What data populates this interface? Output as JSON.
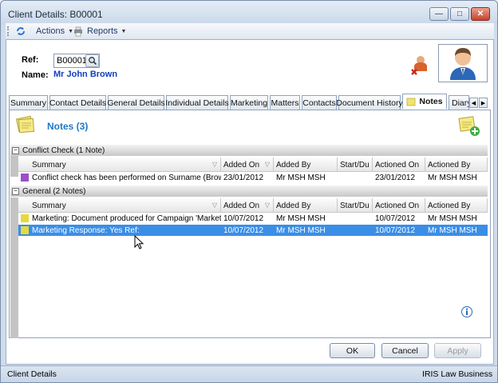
{
  "window": {
    "title": "Client Details: B00001"
  },
  "toolbar": {
    "actions_label": "Actions",
    "reports_label": "Reports"
  },
  "client": {
    "ref_label": "Ref:",
    "ref_value": "B00001",
    "name_label": "Name:",
    "name_value": "Mr John Brown"
  },
  "tabs": [
    {
      "label": "Summary"
    },
    {
      "label": "Contact Details"
    },
    {
      "label": "General Details"
    },
    {
      "label": "Individual Details"
    },
    {
      "label": "Marketing"
    },
    {
      "label": "Matters"
    },
    {
      "label": "Contacts"
    },
    {
      "label": "Document History"
    },
    {
      "label": "Notes",
      "active": true
    },
    {
      "label": "Diary"
    }
  ],
  "notes": {
    "title": "Notes (3)",
    "columns": [
      "Summary",
      "Added On",
      "Added By",
      "Start/Du",
      "Actioned On",
      "Actioned By"
    ],
    "groups": [
      {
        "label": "Conflict Check (1 Note)",
        "rows": [
          {
            "summary": "Conflict check has been performed on Surname (Brow...",
            "added_on": "23/01/2012",
            "added_by": "Mr MSH MSH",
            "start_due": "",
            "actioned_on": "23/01/2012",
            "actioned_by": "Mr MSH MSH",
            "color": "#9b4fc8",
            "selected": false
          }
        ]
      },
      {
        "label": "General (2 Notes)",
        "rows": [
          {
            "summary": "Marketing: Document produced for Campaign 'Marketi...",
            "added_on": "10/07/2012",
            "added_by": "Mr MSH MSH",
            "start_due": "",
            "actioned_on": "10/07/2012",
            "actioned_by": "Mr MSH MSH",
            "color": "#e6d93a",
            "selected": false
          },
          {
            "summary": "Marketing Response: Yes Ref:",
            "added_on": "10/07/2012",
            "added_by": "Mr MSH MSH",
            "start_due": "",
            "actioned_on": "10/07/2012",
            "actioned_by": "Mr MSH MSH",
            "color": "#e6d93a",
            "selected": true
          }
        ]
      }
    ]
  },
  "buttons": {
    "ok": "OK",
    "cancel": "Cancel",
    "apply": "Apply"
  },
  "status": {
    "left": "Client Details",
    "right": "IRIS Law Business"
  },
  "colors": {
    "accent": "#1e78c8",
    "selection": "#3a8ee6",
    "name_link": "#1040c0"
  }
}
